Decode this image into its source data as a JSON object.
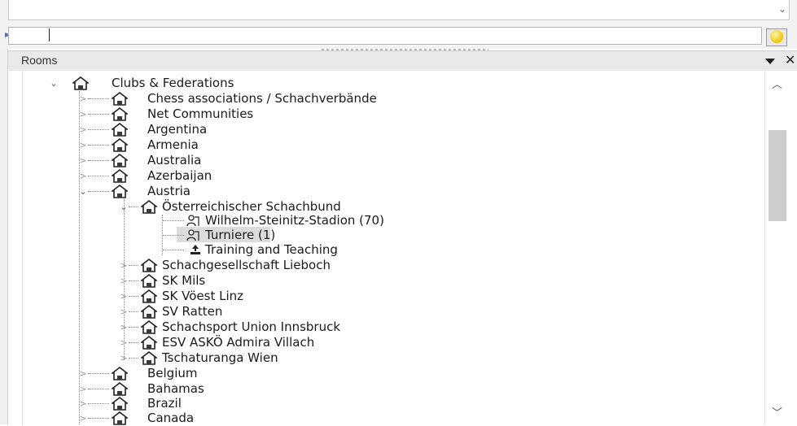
{
  "top": {
    "input_value": ""
  },
  "rooms": {
    "title": "Rooms"
  },
  "tree": {
    "root": "Clubs & Federations",
    "chess_associations": "Chess associations / Schachverbände",
    "net_communities": "Net Communities",
    "argentina": "Argentina",
    "armenia": "Armenia",
    "australia": "Australia",
    "azerbaijan": "Azerbaijan",
    "austria": "Austria",
    "osb": "Österreichischer Schachbund",
    "wilhelm": "Wilhelm-Steinitz-Stadion  (70)",
    "turniere": "Turniere  (1)",
    "training": "Training and Teaching",
    "lieboch": "Schachgesellschaft Lieboch",
    "mils": "SK Mils",
    "voest": "SK Vöest Linz",
    "ratten": "SV Ratten",
    "innsbruck": "Schachsport Union Innsbruck",
    "villach": "ESV ASKÖ Admira Villach",
    "wien": "Tschaturanga Wien",
    "belgium": "Belgium",
    "bahamas": "Bahamas",
    "brazil": "Brazil",
    "canada": "Canada"
  },
  "icons": {
    "house": "house-icon",
    "person": "person-icon",
    "teaching": "teaching-icon",
    "smiley": "smiley-icon"
  },
  "colors": {
    "selection": "#dcdcdc",
    "caret": "#4a76b8"
  }
}
